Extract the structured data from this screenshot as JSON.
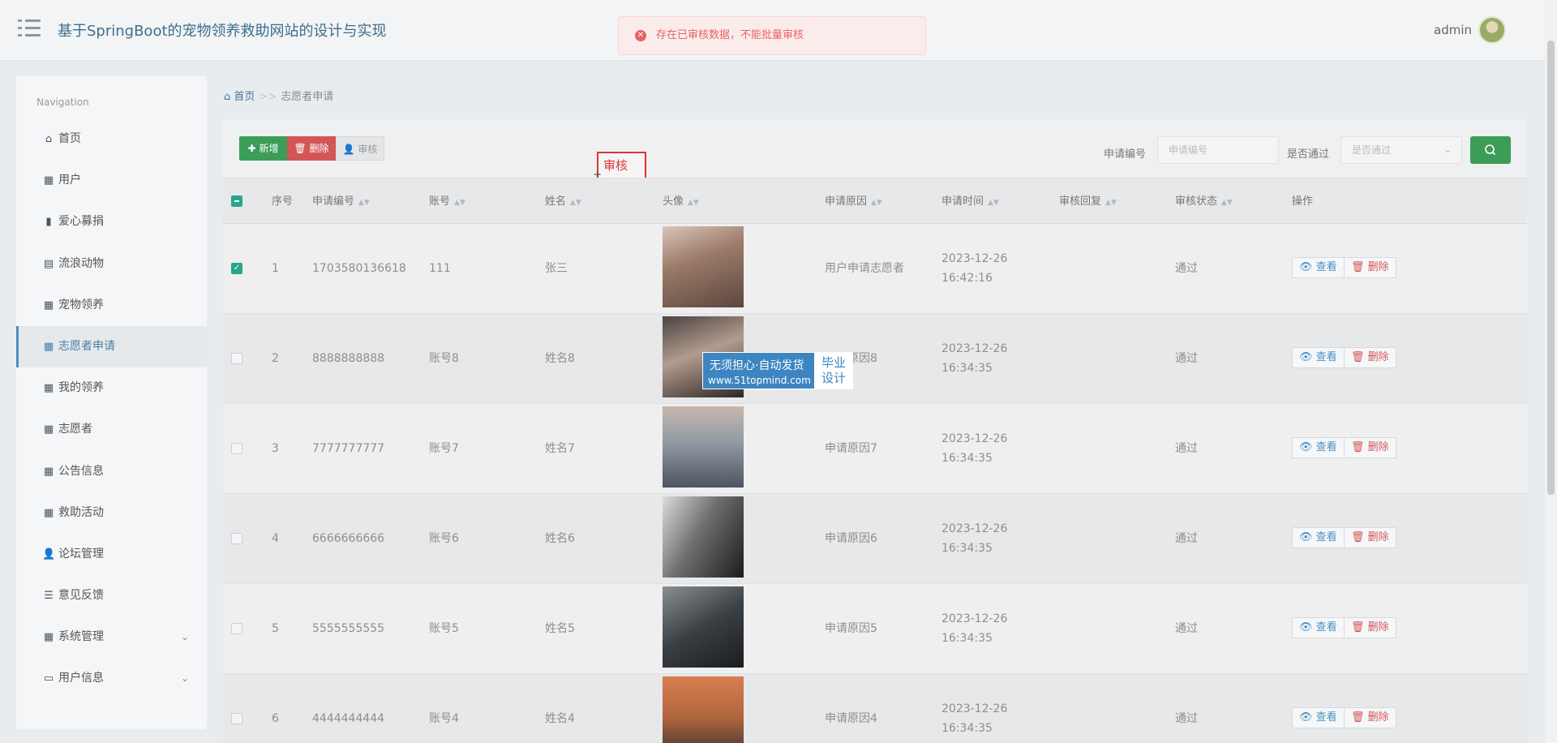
{
  "header": {
    "title": "基于SpringBoot的宠物领养救助网站的设计与实现",
    "user": "admin"
  },
  "toast": {
    "message": "存在已审核数据，不能批量审核"
  },
  "sidebar": {
    "heading": "Navigation",
    "items": [
      {
        "label": "首页",
        "icon": "home-icon"
      },
      {
        "label": "用户",
        "icon": "grid-icon"
      },
      {
        "label": "爱心募捐",
        "icon": "bar-chart-icon"
      },
      {
        "label": "流浪动物",
        "icon": "book-icon"
      },
      {
        "label": "宠物领养",
        "icon": "grid-icon"
      },
      {
        "label": "志愿者申请",
        "icon": "grid-icon",
        "active": true
      },
      {
        "label": "我的领养",
        "icon": "grid-icon"
      },
      {
        "label": "志愿者",
        "icon": "grid-icon"
      },
      {
        "label": "公告信息",
        "icon": "grid-icon"
      },
      {
        "label": "救助活动",
        "icon": "grid-icon"
      },
      {
        "label": "论坛管理",
        "icon": "user-icon"
      },
      {
        "label": "意见反馈",
        "icon": "list-icon"
      },
      {
        "label": "系统管理",
        "icon": "grid-icon",
        "expandable": true
      },
      {
        "label": "用户信息",
        "icon": "card-icon",
        "expandable": true
      }
    ]
  },
  "breadcrumb": {
    "home": "首页",
    "separator": ">>",
    "current": "志愿者申请"
  },
  "toolbar": {
    "add_label": "新增",
    "delete_label": "删除",
    "audit_label": "审核",
    "audit_tooltip": "审核"
  },
  "filters": {
    "app_no_label": "申请编号",
    "app_no_placeholder": "申请编号",
    "passed_label": "是否通过",
    "passed_placeholder": "是否通过"
  },
  "table": {
    "columns": [
      "序号",
      "申请编号",
      "账号",
      "姓名",
      "头像",
      "申请原因",
      "申请时间",
      "审核回复",
      "审核状态",
      "操作"
    ],
    "view_label": "查看",
    "delete_label": "删除",
    "rows": [
      {
        "index": "1",
        "app_no": "1703580136618",
        "account": "111",
        "name": "张三",
        "reason": "用户申请志愿者",
        "time": "2023-12-26 16:42:16",
        "reply": "",
        "status": "通过",
        "checked": true
      },
      {
        "index": "2",
        "app_no": "8888888888",
        "account": "账号8",
        "name": "姓名8",
        "reason": "申请原因8",
        "time": "2023-12-26 16:34:35",
        "reply": "",
        "status": "通过",
        "checked": false
      },
      {
        "index": "3",
        "app_no": "7777777777",
        "account": "账号7",
        "name": "姓名7",
        "reason": "申请原因7",
        "time": "2023-12-26 16:34:35",
        "reply": "",
        "status": "通过",
        "checked": false
      },
      {
        "index": "4",
        "app_no": "6666666666",
        "account": "账号6",
        "name": "姓名6",
        "reason": "申请原因6",
        "time": "2023-12-26 16:34:35",
        "reply": "",
        "status": "通过",
        "checked": false
      },
      {
        "index": "5",
        "app_no": "5555555555",
        "account": "账号5",
        "name": "姓名5",
        "reason": "申请原因5",
        "time": "2023-12-26 16:34:35",
        "reply": "",
        "status": "通过",
        "checked": false
      },
      {
        "index": "6",
        "app_no": "4444444444",
        "account": "账号4",
        "name": "姓名4",
        "reason": "申请原因4",
        "time": "2023-12-26 16:34:35",
        "reply": "",
        "status": "通过",
        "checked": false
      }
    ]
  },
  "watermark": {
    "line1": "无须担心·自动发货",
    "line2": "www.51topmind.com",
    "badge_top": "毕业",
    "badge_bottom": "设计"
  },
  "colors": {
    "primary_green": "#3b9d57",
    "danger_red": "#d35656",
    "accent_blue": "#4a90c2",
    "check_teal": "#2aa58b"
  }
}
